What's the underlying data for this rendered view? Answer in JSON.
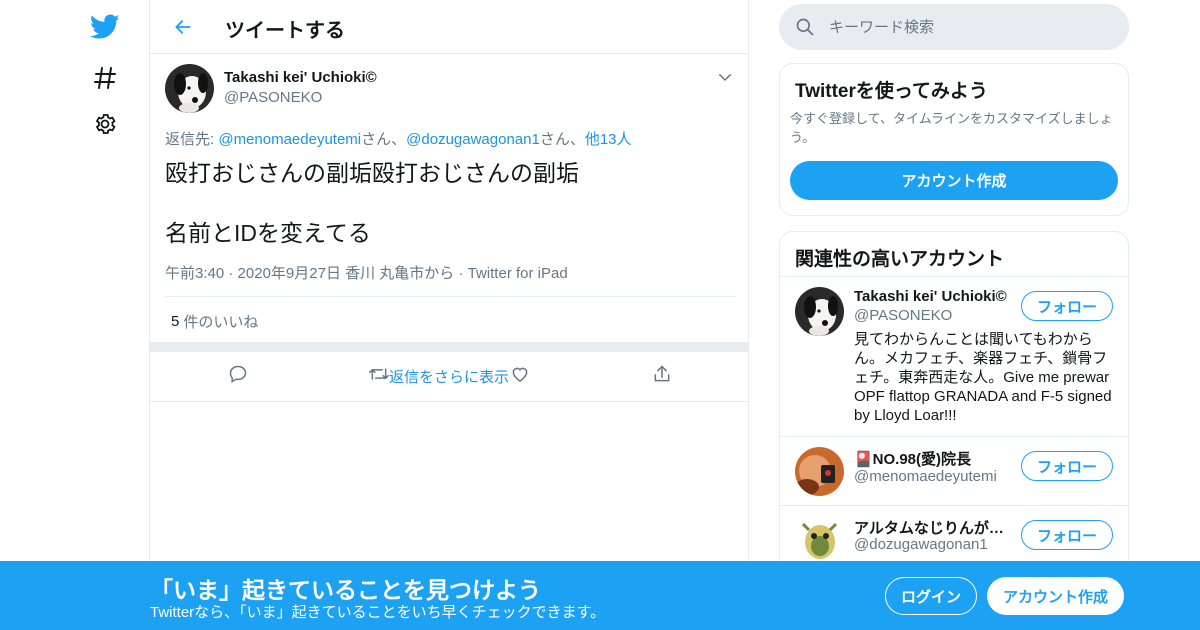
{
  "colors": {
    "accent": "#1da1f2",
    "link": "#1b95e0",
    "text": "#14171a",
    "secondary": "#657786",
    "border": "#e6ecf0"
  },
  "nav": {
    "icons": [
      "twitter-bird-icon",
      "hashtag-icon",
      "gear-icon"
    ]
  },
  "header": {
    "title": "ツイートする",
    "back_icon": "back-arrow-icon"
  },
  "tweet": {
    "author_name": "Takashi kei' Uchioki©",
    "author_handle": "@PASONEKO",
    "reply_prefix": "返信先: ",
    "reply_user1": "@menomaedeyutemi",
    "reply_sep1": "さん、",
    "reply_user2": "@dozugawagonan1",
    "reply_sep2": "さん、",
    "reply_others": "他13人",
    "text_line1": "殴打おじさんの副垢殴打おじさんの副垢",
    "text_line2": "名前とIDを変えてる",
    "time": "午前3:40",
    "date": "2020年9月27日",
    "location": "香川 丸亀市から",
    "source": "Twitter for iPad",
    "like_count": "5",
    "like_label": "件のいいね",
    "actions": [
      "reply-icon",
      "retweet-icon",
      "like-icon",
      "share-icon"
    ],
    "more_replies": "返信をさらに表示"
  },
  "search": {
    "placeholder": "キーワード検索"
  },
  "signup_card": {
    "title": "Twitterを使ってみよう",
    "description": "今すぐ登録して、タイムラインをカスタマイズしましょう。",
    "button": "アカウント作成"
  },
  "related": {
    "title": "関連性の高いアカウント",
    "follow_label": "フォロー",
    "users": [
      {
        "name": "Takashi kei' Uchioki©",
        "handle": "@PASONEKO",
        "bio": "見てわからんことは聞いてもわからん。メカフェチ、楽器フェチ、鎖骨フェチ。東奔西走な人。Give me prewar OPF flattop GRANADA and F-5 signed by Lloyd Loar!!!"
      },
      {
        "name": "🎴NO.98(愛)院長",
        "handle": "@menomaedeyutemi",
        "bio": ""
      },
      {
        "name": "アルタムなじりんが…",
        "handle": "@dozugawagonan1",
        "bio": ""
      }
    ]
  },
  "banner": {
    "title": "「いま」起きていることを見つけよう",
    "subtitle": "Twitterなら、「いま」起きていることをいち早くチェックできます。",
    "login": "ログイン",
    "signup": "アカウント作成"
  }
}
